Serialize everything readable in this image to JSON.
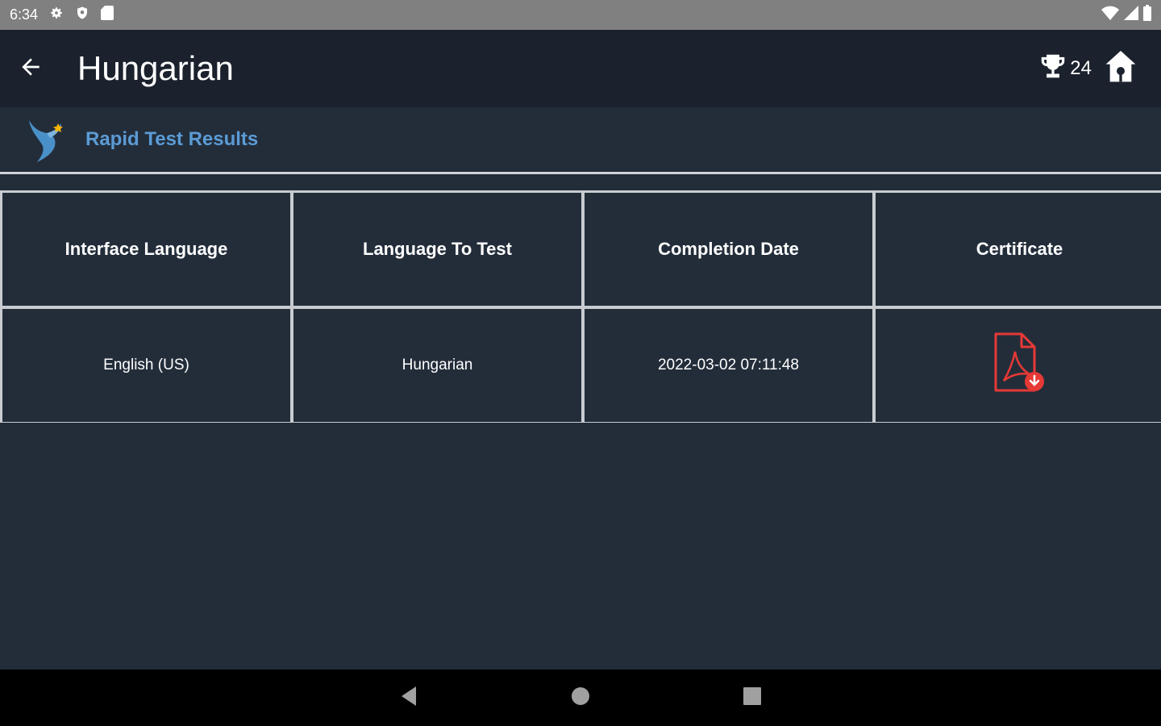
{
  "status_bar": {
    "time": "6:34",
    "icons": [
      "settings-icon",
      "shield-icon",
      "sd-card-icon",
      "wifi-icon",
      "signal-icon",
      "battery-icon"
    ]
  },
  "appbar": {
    "title": "Hungarian",
    "trophy_count": "24",
    "icons": [
      "back-arrow-icon",
      "trophy-icon",
      "home-icon"
    ]
  },
  "subheader": {
    "title": "Rapid Test Results",
    "icon": "bird-logo-icon"
  },
  "table": {
    "headers": [
      "Interface Language",
      "Language To Test",
      "Completion Date",
      "Certificate"
    ],
    "rows": [
      {
        "interface_language": "English (US)",
        "language_to_test": "Hungarian",
        "completion_date": "2022-03-02 07:11:48",
        "certificate_icon": "pdf-icon"
      }
    ]
  },
  "nav_bar": {
    "icons": [
      "nav-back-icon",
      "nav-home-icon",
      "nav-recents-icon"
    ]
  },
  "colors": {
    "background": "#232d3a",
    "appbar": "#1b222d",
    "accent": "#5b9bd5",
    "pdf_red": "#e53935"
  }
}
